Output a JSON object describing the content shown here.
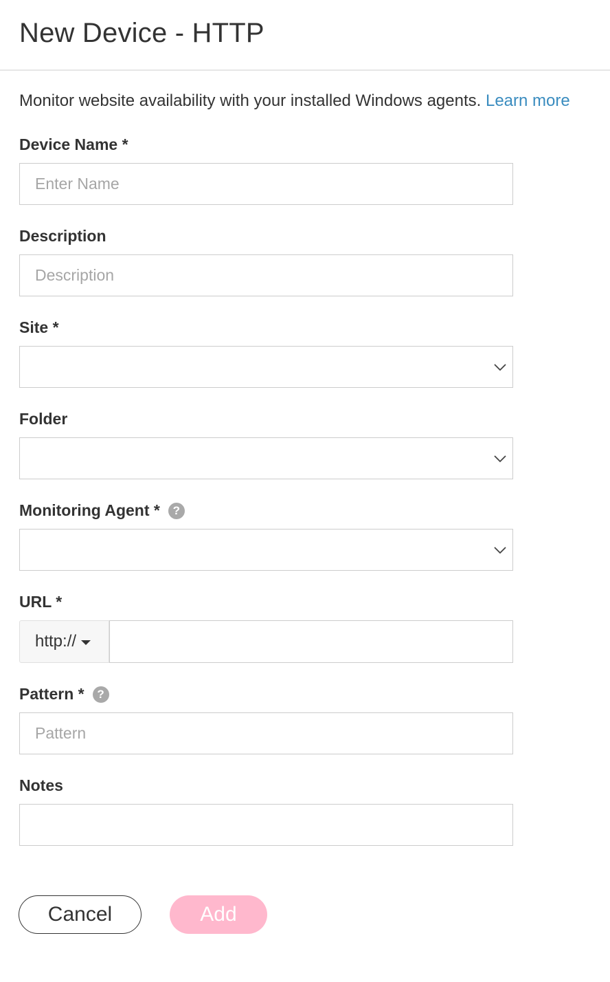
{
  "header": {
    "title": "New Device - HTTP"
  },
  "intro": {
    "text": "Monitor website availability with your installed Windows agents.",
    "link": "Learn more"
  },
  "form": {
    "device_name": {
      "label": "Device Name *",
      "placeholder": "Enter Name",
      "value": ""
    },
    "description": {
      "label": "Description",
      "placeholder": "Description",
      "value": ""
    },
    "site": {
      "label": "Site *",
      "value": ""
    },
    "folder": {
      "label": "Folder",
      "value": ""
    },
    "monitoring_agent": {
      "label": "Monitoring Agent *",
      "help": "?",
      "value": ""
    },
    "url": {
      "label": "URL *",
      "protocol": "http://",
      "value": ""
    },
    "pattern": {
      "label": "Pattern *",
      "help": "?",
      "placeholder": "Pattern",
      "value": ""
    },
    "notes": {
      "label": "Notes",
      "value": ""
    }
  },
  "actions": {
    "cancel": "Cancel",
    "add": "Add"
  },
  "colors": {
    "link": "#3a8cbf",
    "add_button": "#ffb8cd",
    "help_icon": "#a9a9a9"
  }
}
